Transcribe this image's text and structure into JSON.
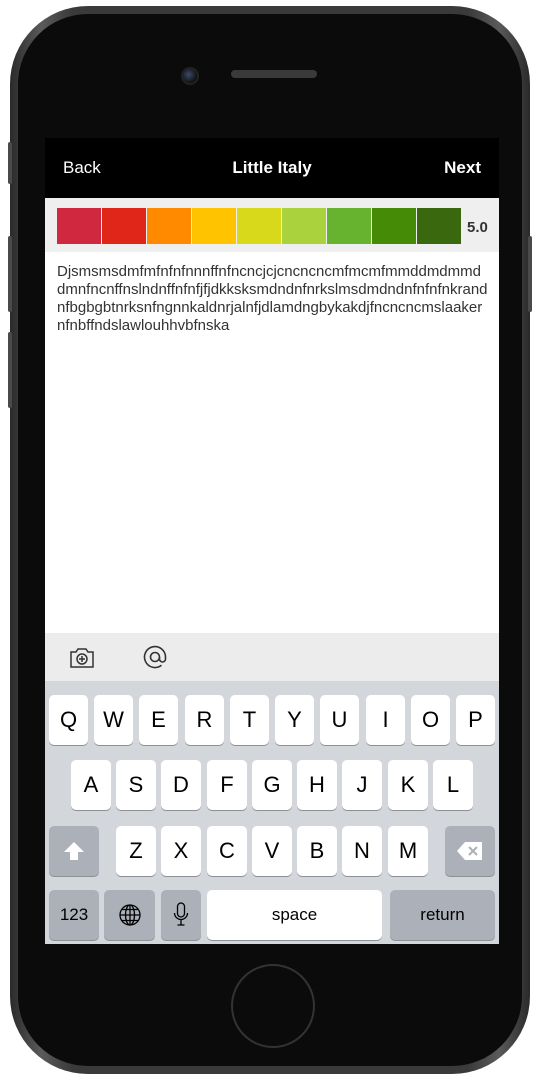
{
  "nav": {
    "back": "Back",
    "title": "Little Italy",
    "next": "Next"
  },
  "rating": {
    "value": "5.0",
    "colors": [
      "#d0283e",
      "#e02619",
      "#ff8a00",
      "#ffc300",
      "#d9d91c",
      "#a9d23c",
      "#67b330",
      "#458b06",
      "#3a680f"
    ]
  },
  "review": {
    "text": "Djsmsmsdmfmfnfnfnnnffnfncncjcjcncncncmfmcmfmmddmdmmddmnfncnffnslndnffnfnfjfjdkksksmdndnfnrkslmsdmdndnfnfnfnkrandnfbgbgbtnrksnfngnnkaldnrjalnfjdlamdngbykakdjfncncncmslaakernfnbffndslawlouhhvbfnska"
  },
  "toolbar": {
    "icons": [
      "camera-plus-icon",
      "at-sign-icon"
    ]
  },
  "keyboard": {
    "row1": [
      "Q",
      "W",
      "E",
      "R",
      "T",
      "Y",
      "U",
      "I",
      "O",
      "P"
    ],
    "row2": [
      "A",
      "S",
      "D",
      "F",
      "G",
      "H",
      "J",
      "K",
      "L"
    ],
    "row3": [
      "Z",
      "X",
      "C",
      "V",
      "B",
      "N",
      "M"
    ],
    "numbers": "123",
    "space": "space",
    "return": "return"
  }
}
